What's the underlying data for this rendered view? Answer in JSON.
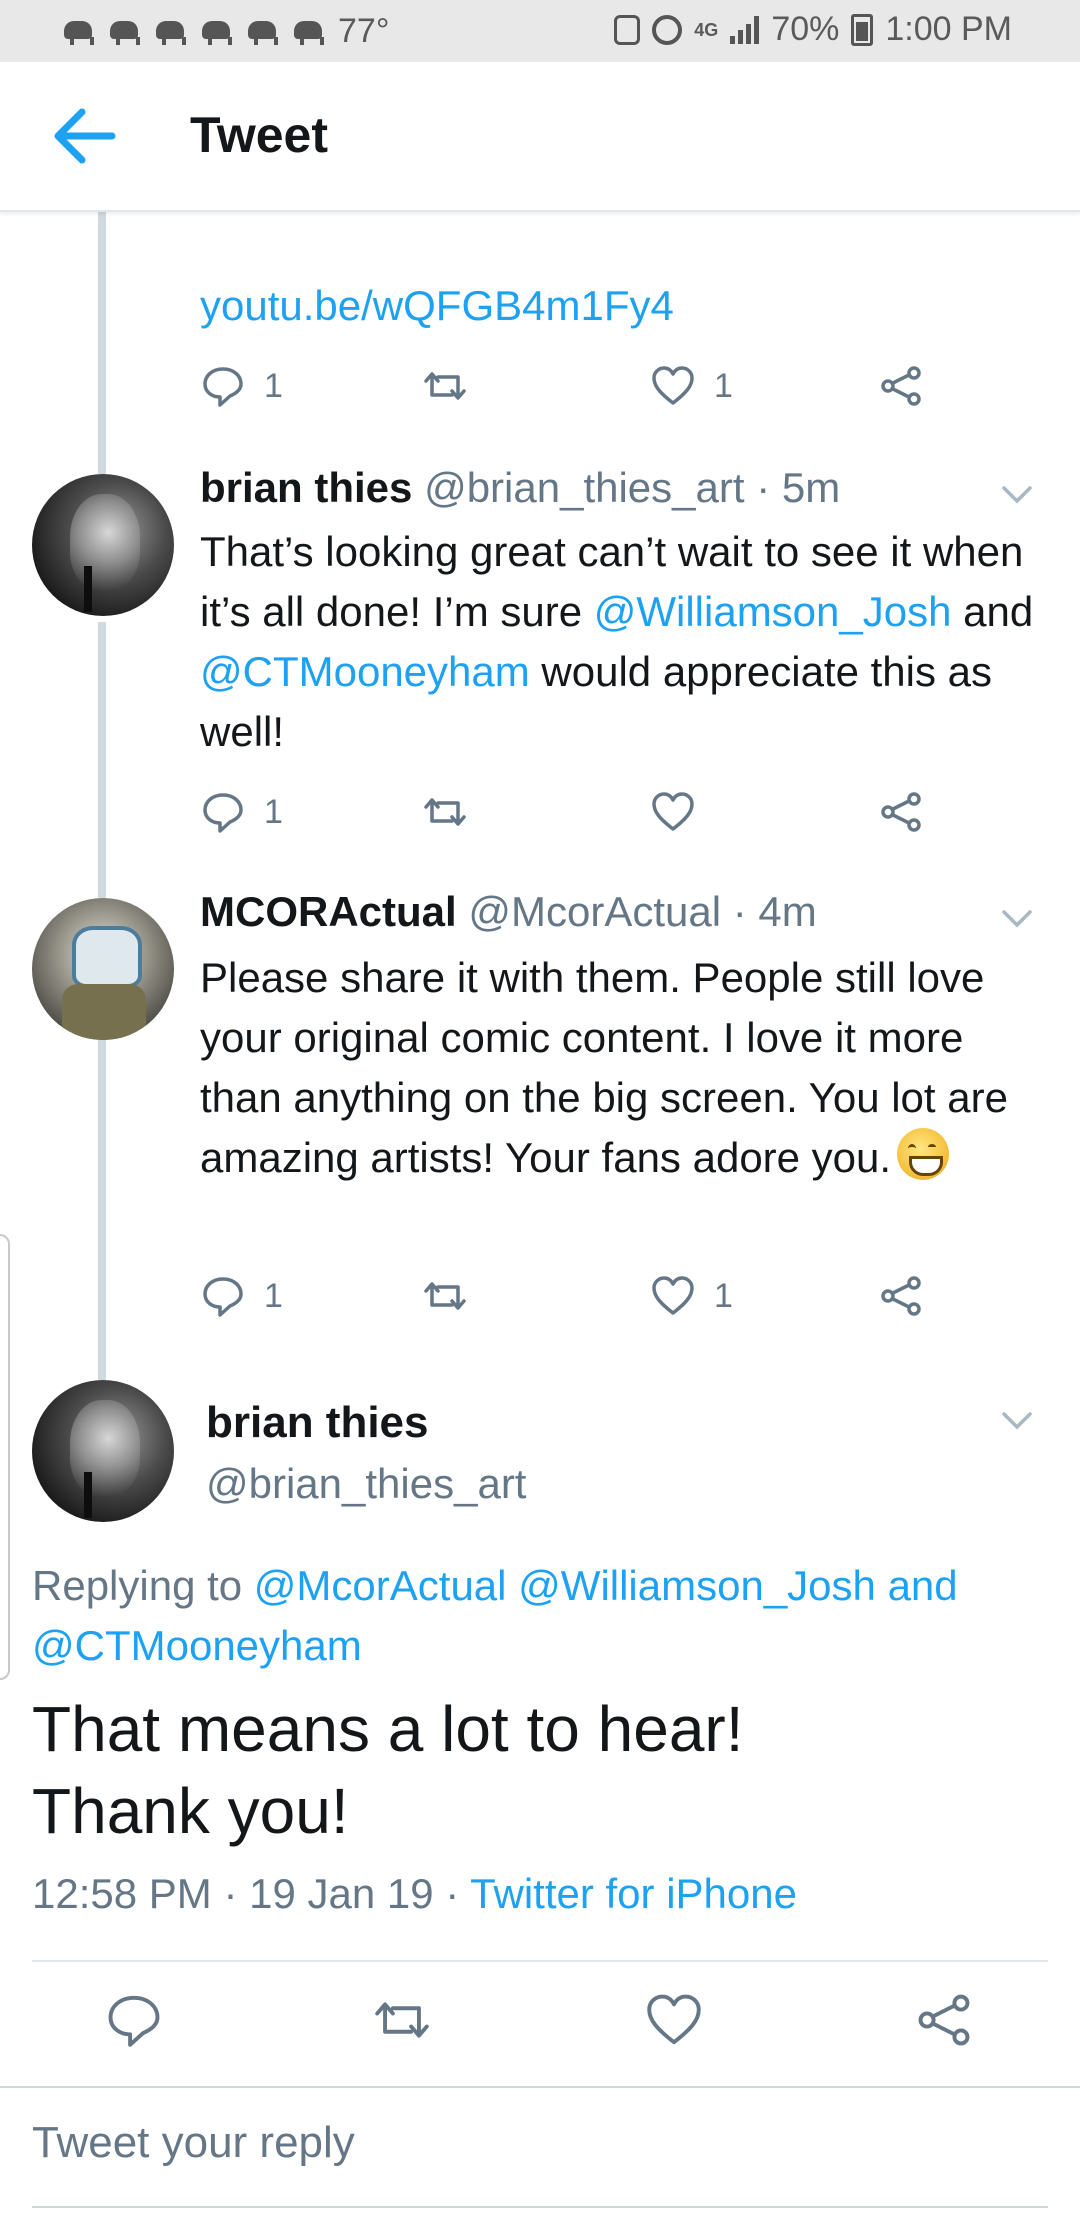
{
  "status_bar": {
    "temperature": "77°",
    "network": "4G",
    "battery": "70%",
    "time": "1:00 PM"
  },
  "app_bar": {
    "title": "Tweet"
  },
  "previous_tweet": {
    "link": "youtu.be/wQFGB4m1Fy4",
    "reply_count": "1",
    "like_count": "1"
  },
  "replies": [
    {
      "name": "brian thies",
      "handle": "@brian_thies_art · 5m",
      "text_1": "That’s looking great can’t wait to see it when it’s all done! I’m sure ",
      "mention_1": "@Williamson_Josh",
      "text_2": " and ",
      "mention_2": "@CTMooneyham",
      "text_3": " would appreciate this as well!",
      "reply_count": "1",
      "like_count": ""
    },
    {
      "name": "MCORActual",
      "handle": "@McorActual · 4m",
      "text": "Please share it with them. People still love your original comic content. I love it more than anything on the big screen. You lot are amazing artists! Your fans adore you.",
      "reply_count": "1",
      "like_count": "1"
    }
  ],
  "main_tweet": {
    "name": "brian thies",
    "handle": "@brian_thies_art",
    "replying_prefix": "Replying to ",
    "replying_mentions": "@McorActual @Williamson_Josh and @CTMooneyham",
    "text_line1": "That means a lot to hear!",
    "text_line2": "Thank you!",
    "timestamp": "12:58 PM · 19 Jan 19 · ",
    "source": "Twitter for iPhone"
  },
  "reply_box": {
    "placeholder": "Tweet your reply"
  },
  "colors": {
    "accent": "#1da1f2",
    "secondary_text": "#657786"
  }
}
